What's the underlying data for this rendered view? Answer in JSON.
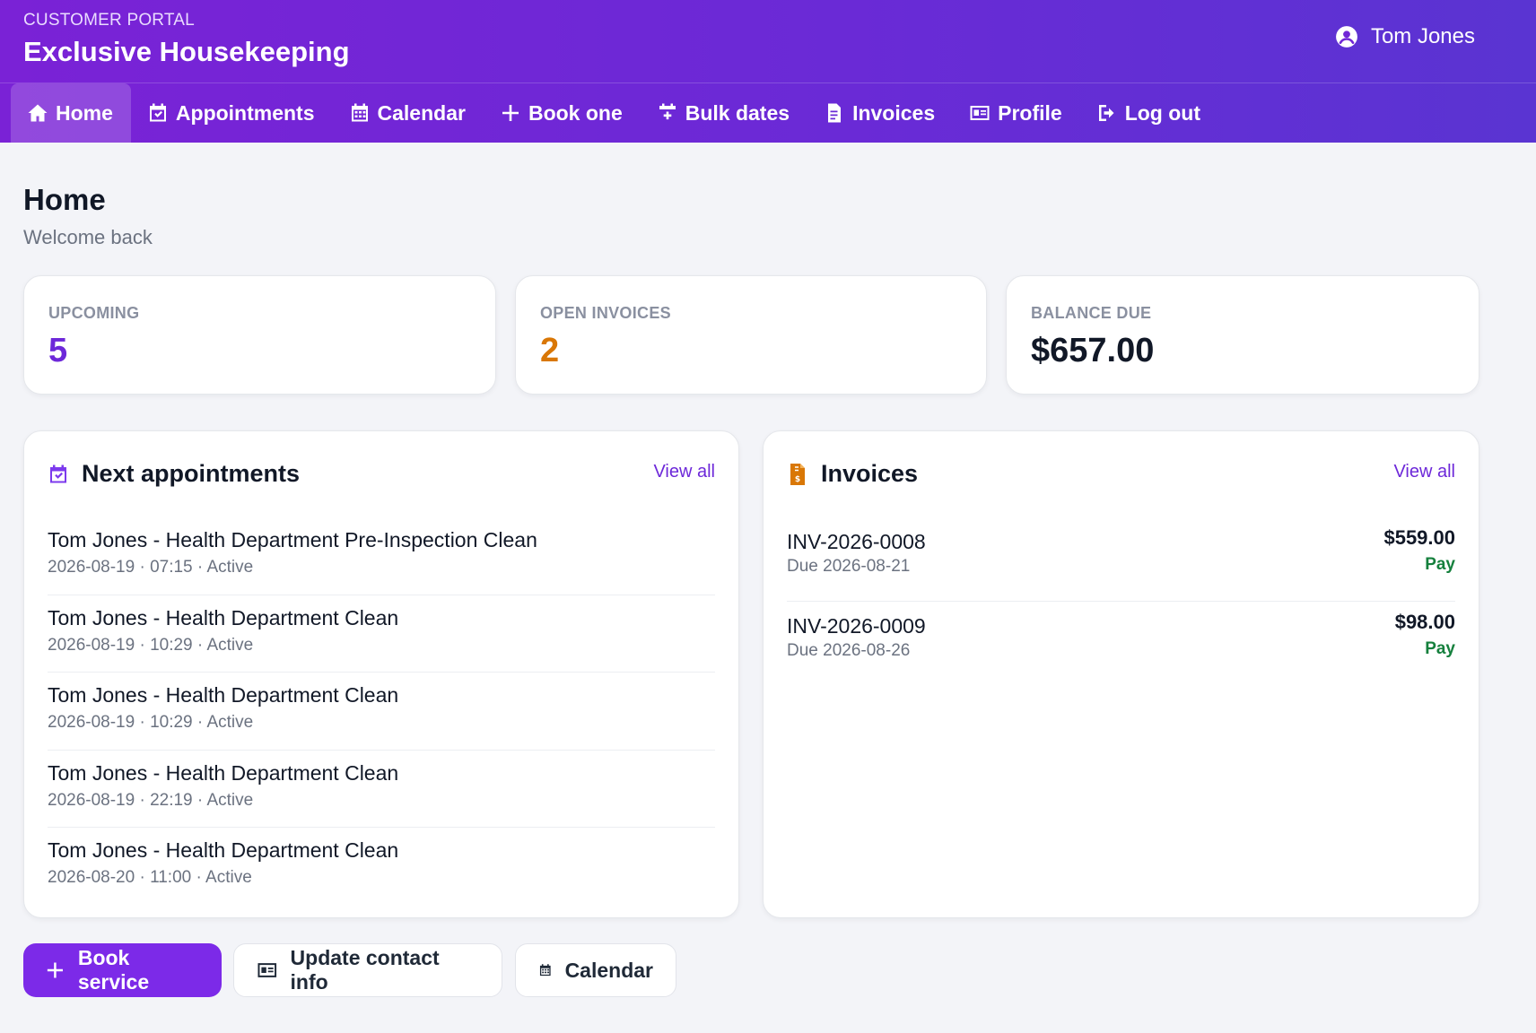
{
  "header": {
    "subtitle": "CUSTOMER PORTAL",
    "title": "Exclusive Housekeeping",
    "user_name": "Tom Jones"
  },
  "nav": {
    "items": [
      {
        "label": "Home",
        "icon": "home-icon",
        "active": true
      },
      {
        "label": "Appointments",
        "icon": "calendar-check-icon"
      },
      {
        "label": "Calendar",
        "icon": "calendar-icon"
      },
      {
        "label": "Book one",
        "icon": "plus-icon"
      },
      {
        "label": "Bulk dates",
        "icon": "calendar-plus-icon"
      },
      {
        "label": "Invoices",
        "icon": "invoice-icon"
      },
      {
        "label": "Profile",
        "icon": "id-card-icon"
      },
      {
        "label": "Log out",
        "icon": "logout-icon"
      }
    ]
  },
  "page": {
    "title": "Home",
    "subtitle": "Welcome back"
  },
  "stats": [
    {
      "label": "UPCOMING",
      "value": "5",
      "color": "#6d28d9"
    },
    {
      "label": "OPEN INVOICES",
      "value": "2",
      "color": "#d97706"
    },
    {
      "label": "BALANCE DUE",
      "value": "$657.00",
      "color": "#111827"
    }
  ],
  "appointments": {
    "title": "Next appointments",
    "view_all": "View all",
    "items": [
      {
        "title": "Tom Jones - Health Department Pre-Inspection Clean",
        "meta": "2026-08-19 · 07:15 · Active"
      },
      {
        "title": "Tom Jones - Health Department Clean",
        "meta": "2026-08-19 · 10:29 · Active"
      },
      {
        "title": "Tom Jones - Health Department Clean",
        "meta": "2026-08-19 · 10:29 · Active"
      },
      {
        "title": "Tom Jones - Health Department Clean",
        "meta": "2026-08-19 · 22:19 · Active"
      },
      {
        "title": "Tom Jones - Health Department Clean",
        "meta": "2026-08-20 · 11:00 · Active"
      }
    ]
  },
  "invoices": {
    "title": "Invoices",
    "view_all": "View all",
    "items": [
      {
        "number": "INV-2026-0008",
        "due": "Due 2026-08-21",
        "amount": "$559.00",
        "action": "Pay"
      },
      {
        "number": "INV-2026-0009",
        "due": "Due 2026-08-26",
        "amount": "$98.00",
        "action": "Pay"
      }
    ]
  },
  "actions": {
    "book_service": "Book service",
    "update_contact": "Update contact info",
    "calendar": "Calendar"
  },
  "colors": {
    "accent": "#7c2ae8",
    "pay": "#15803d",
    "invoice_icon": "#d97706"
  }
}
